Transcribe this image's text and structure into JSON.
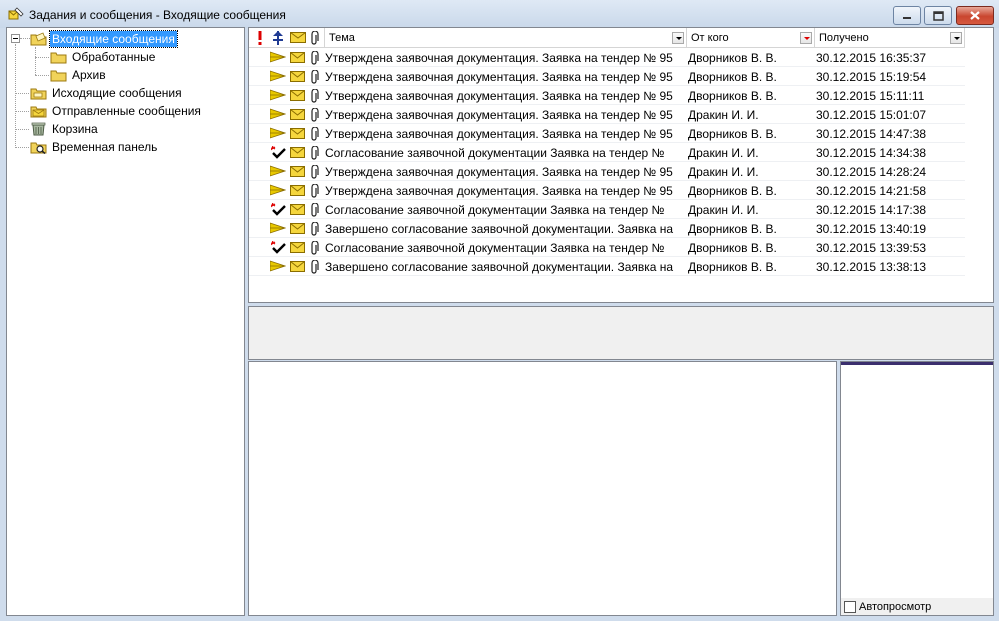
{
  "window": {
    "title": "Задания и сообщения - Входящие сообщения",
    "app_icon": "envelope-pen-icon"
  },
  "tree": {
    "items": [
      {
        "label": "Входящие сообщения",
        "icon": "inbox-folder-icon",
        "selected": true
      },
      {
        "label": "Обработанные",
        "icon": "folder-icon"
      },
      {
        "label": "Архив",
        "icon": "folder-icon"
      },
      {
        "label": "Исходящие сообщения",
        "icon": "outbox-folder-icon"
      },
      {
        "label": "Отправленные сообщения",
        "icon": "sent-folder-icon"
      },
      {
        "label": "Корзина",
        "icon": "trash-icon"
      },
      {
        "label": "Временная панель",
        "icon": "temp-panel-icon"
      }
    ]
  },
  "list": {
    "columns": {
      "importance_icon": "exclamation-icon",
      "type_icon": "pin-icon",
      "status_icon": "envelope-icon",
      "attachment_icon": "paperclip-icon",
      "subject": "Тема",
      "from": "От кого",
      "received": "Получено"
    },
    "rows": [
      {
        "type": "forward",
        "subject": "Утверждена заявочная документация. Заявка на тендер № 95",
        "from": "Дворников В. В.",
        "received": "30.12.2015 16:35:37"
      },
      {
        "type": "forward",
        "subject": "Утверждена заявочная документация. Заявка на тендер № 95",
        "from": "Дворников В. В.",
        "received": "30.12.2015 15:19:54"
      },
      {
        "type": "forward",
        "subject": "Утверждена заявочная документация. Заявка на тендер № 95",
        "from": "Дворников В. В.",
        "received": "30.12.2015 15:11:11"
      },
      {
        "type": "forward",
        "subject": "Утверждена заявочная документация. Заявка на тендер № 95",
        "from": "Дракин И. И.",
        "received": "30.12.2015 15:01:07"
      },
      {
        "type": "forward",
        "subject": "Утверждена заявочная документация. Заявка на тендер № 95",
        "from": "Дворников В. В.",
        "received": "30.12.2015 14:47:38"
      },
      {
        "type": "task",
        "subject": "Согласование заявочной документации Заявка на тендер №",
        "from": "Дракин И. И.",
        "received": "30.12.2015 14:34:38"
      },
      {
        "type": "forward",
        "subject": "Утверждена заявочная документация. Заявка на тендер № 95",
        "from": "Дракин И. И.",
        "received": "30.12.2015 14:28:24"
      },
      {
        "type": "forward",
        "subject": "Утверждена заявочная документация. Заявка на тендер № 95",
        "from": "Дворников В. В.",
        "received": "30.12.2015 14:21:58"
      },
      {
        "type": "task",
        "subject": "Согласование заявочной документации Заявка на тендер №",
        "from": "Дракин И. И.",
        "received": "30.12.2015 14:17:38"
      },
      {
        "type": "forward",
        "subject": "Завершено согласование заявочной документации. Заявка на",
        "from": "Дворников В. В.",
        "received": "30.12.2015 13:40:19"
      },
      {
        "type": "task",
        "subject": "Согласование заявочной документации Заявка на тендер №",
        "from": "Дворников В. В.",
        "received": "30.12.2015 13:39:53"
      },
      {
        "type": "forward",
        "subject": "Завершено согласование заявочной документации. Заявка на",
        "from": "Дворников В. В.",
        "received": "30.12.2015 13:38:13"
      }
    ]
  },
  "preview": {
    "autopreview_label": "Автопросмотр",
    "autopreview_checked": false
  },
  "colors": {
    "selection": "#3399ff",
    "envelope": "#f5d63d",
    "flag": "#e8c800",
    "task_mark": "#d00000"
  }
}
